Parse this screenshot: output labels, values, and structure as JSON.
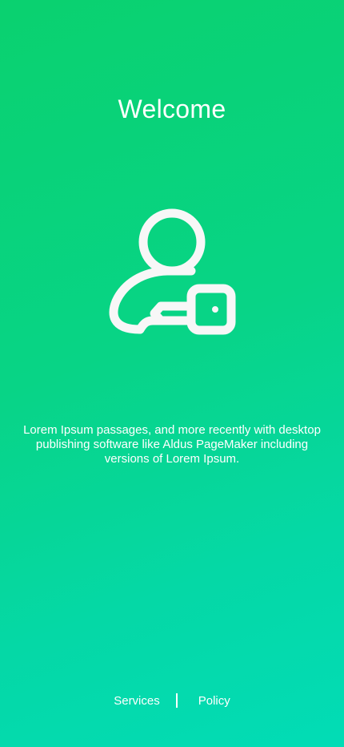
{
  "header": {
    "title": "Welcome"
  },
  "hero": {
    "icon": "user-key-icon"
  },
  "body": {
    "description": "Lorem Ipsum passages, and more recently with desktop publishing software like Aldus PageMaker including versions of Lorem Ipsum."
  },
  "footer": {
    "services_label": "Services",
    "policy_label": "Policy"
  },
  "colors": {
    "gradient_start": "#0ad16f",
    "gradient_end": "#02dcb6",
    "text": "#ffffff",
    "icon": "#f7f7f7"
  }
}
